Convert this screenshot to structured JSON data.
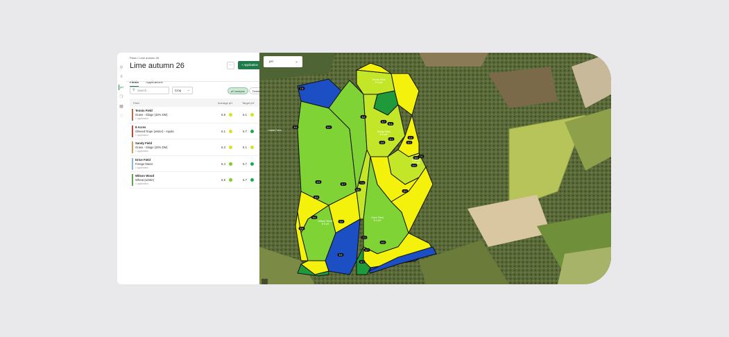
{
  "sidebar": {
    "items": [
      {
        "name": "filter",
        "glyph": "⚲"
      },
      {
        "name": "layers",
        "glyph": "≡"
      },
      {
        "name": "ph",
        "glyph": "pH"
      },
      {
        "name": "chat",
        "glyph": "❍"
      },
      {
        "name": "grid",
        "glyph": "▦"
      },
      {
        "name": "help",
        "glyph": "♡"
      }
    ],
    "active_index": 2
  },
  "breadcrumb": {
    "root": "Plans",
    "separator": "/",
    "current": "Lime autumn 26"
  },
  "page_title": "Lime autumn 26",
  "toolbar": {
    "more_label": "···",
    "application_label": "+ Application"
  },
  "tabs": [
    {
      "label": "Fields",
      "active": true
    },
    {
      "label": "Applications",
      "active": false
    }
  ],
  "filters": {
    "search_placeholder": "Search...",
    "crop_select": "Crop",
    "ph_analysis_chip": "pH analysis",
    "delete_chip": "Delete"
  },
  "table": {
    "headers": {
      "field": "Field",
      "average_ph": "Average pH",
      "target_ph": "Target pH"
    },
    "rows": [
      {
        "name": "Tennis Field",
        "crop": "Grass - Silage (33% DM)",
        "apps": "1 application",
        "avg": "5.9",
        "avg_color": "#d7e31e",
        "target": "6.1",
        "target_color": "#d7e31e",
        "bar_color": "#b86b4b"
      },
      {
        "name": "8 Acres",
        "crop": "Oilseed Rape (winter) - Aquila",
        "apps": "1 application",
        "avg": "6.1",
        "avg_color": "#d7e31e",
        "target": "6.7",
        "target_color": "#1faa4b",
        "bar_color": "#b84a3b"
      },
      {
        "name": "Sandy Field",
        "crop": "Grass - Silage (33% DM)",
        "apps": "1 application",
        "avg": "6.3",
        "avg_color": "#d7e31e",
        "target": "6.1",
        "target_color": "#d7e31e",
        "bar_color": "#c9a05a"
      },
      {
        "name": "Drive Field",
        "crop": "Forage Maize",
        "apps": "1 application",
        "avg": "6.4",
        "avg_color": "#7dcc2c",
        "target": "6.7",
        "target_color": "#1faa4b",
        "bar_color": "#8fb8d8"
      },
      {
        "name": "Wilson Wood",
        "crop": "Wheat (winter)",
        "apps": "1 application",
        "avg": "6.5",
        "avg_color": "#7dcc2c",
        "target": "6.7",
        "target_color": "#1faa4b",
        "bar_color": "#5aa84a"
      }
    ]
  },
  "map": {
    "layer_select": "pH",
    "colors": {
      "blue": "#1d4fc4",
      "dark_green": "#1f9a3a",
      "green": "#7fd335",
      "lime": "#c3e629",
      "yellow": "#f4f20c",
      "outline": "#111111"
    },
    "zone_values": [
      "7.4",
      "5.9",
      "6.1",
      "6.2",
      "6.7",
      "6.4",
      "6.1",
      "6.8",
      "6.3",
      "6.2",
      "7.0",
      "6.6",
      "6.4",
      "6.2",
      "6.5",
      "6.9",
      "7.4",
      "6.7",
      "6.6",
      "5.8",
      "6.5",
      "7.2",
      "6.6",
      "5.9",
      "6.7",
      "6.7",
      "6.4"
    ],
    "field_labels": [
      {
        "name": "Tennis Field",
        "sub": "5.9 pH"
      },
      {
        "name": "Sandy Field",
        "sub": "6.3 pH"
      },
      {
        "name": "8 Acres",
        "sub": "6.1 pH"
      },
      {
        "name": "Wilson Wood",
        "sub": "6.5 pH"
      },
      {
        "name": "Drive Field",
        "sub": "6.4 pH"
      }
    ],
    "place_label": "Castle Farm"
  }
}
